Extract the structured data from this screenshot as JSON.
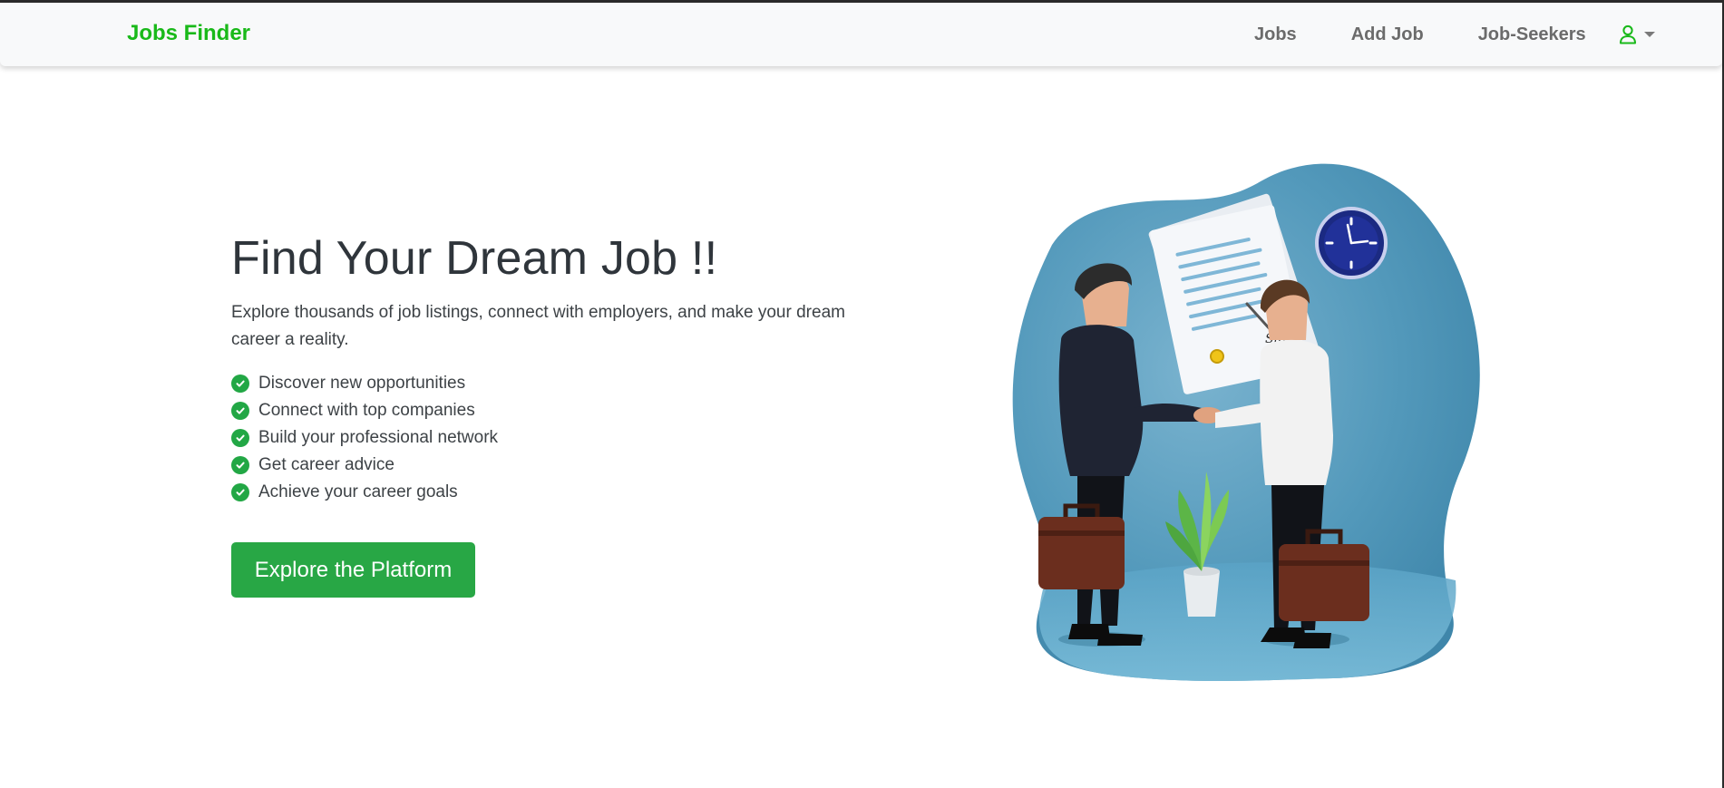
{
  "brand": {
    "name": "Jobs Finder",
    "color": "#19b919"
  },
  "nav": {
    "items": [
      {
        "label": "Jobs"
      },
      {
        "label": "Add Job"
      },
      {
        "label": "Job-Seekers"
      }
    ],
    "user_icon": "user-icon"
  },
  "hero": {
    "title": "Find Your Dream Job !!",
    "description": "Explore thousands of job listings, connect with employers, and make your dream career a reality.",
    "features": [
      "Discover new opportunities",
      "Connect with top companies",
      "Build your professional network",
      "Get career advice",
      "Achieve your career goals"
    ],
    "cta_label": "Explore the Platform",
    "accent_color": "#28a745",
    "illustration": "handshake-illustration",
    "sign_text": "Sign"
  }
}
